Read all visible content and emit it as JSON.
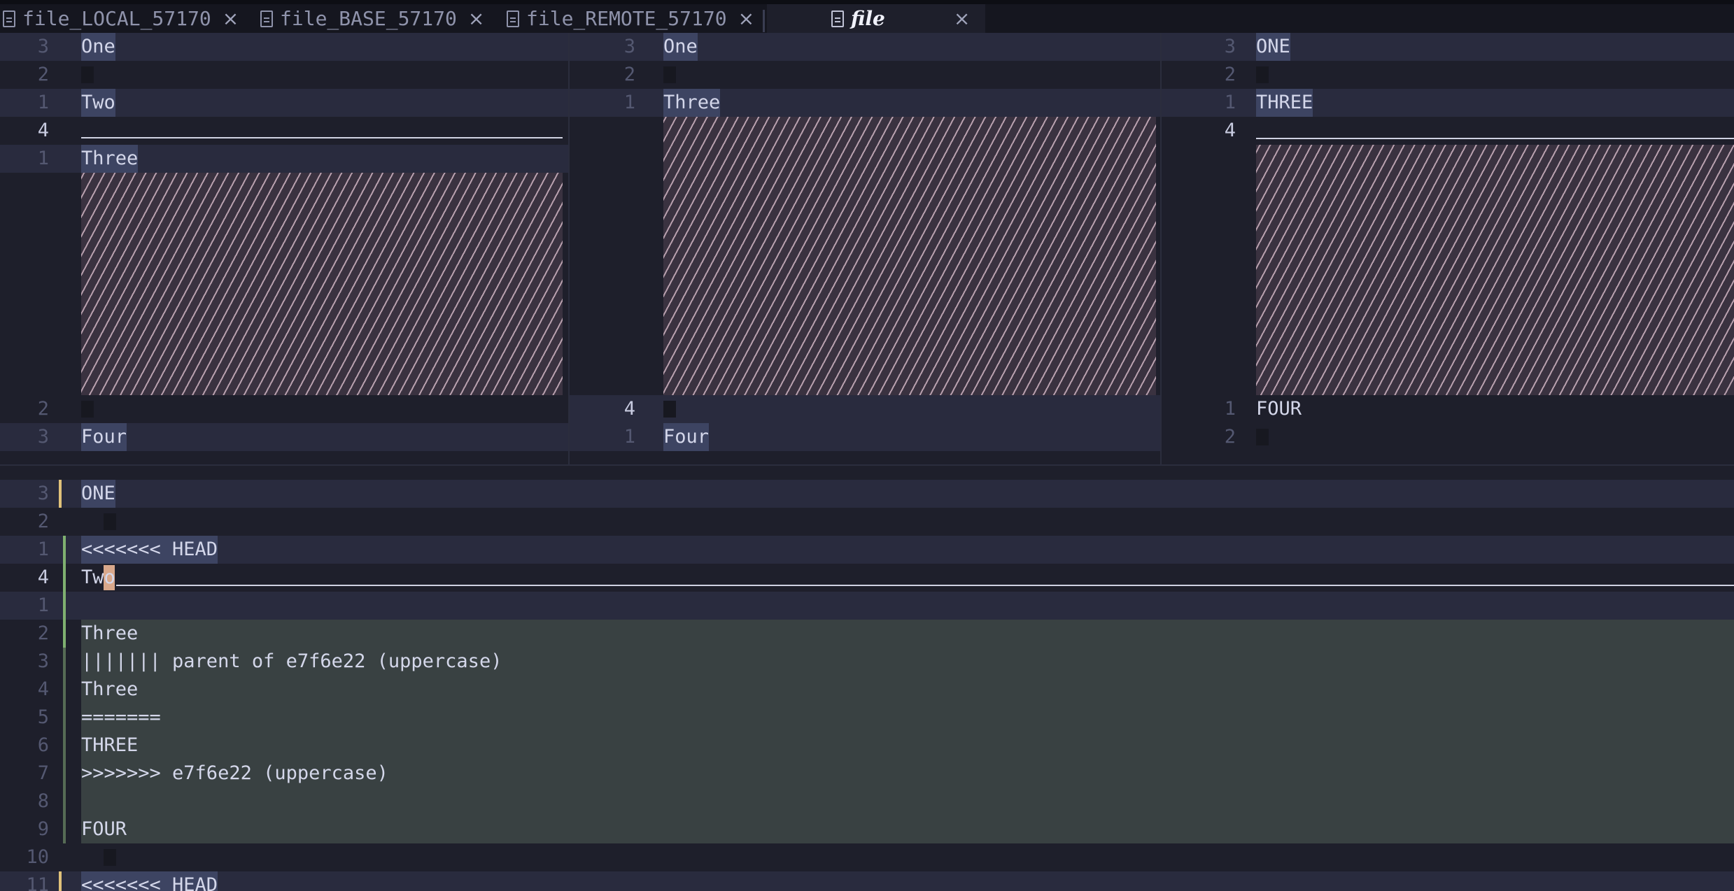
{
  "tabs": [
    {
      "label": "file_LOCAL_57170",
      "close": "×"
    },
    {
      "label": "file_BASE_57170",
      "close": "×"
    },
    {
      "label": "file_REMOTE_57170",
      "close": "×"
    },
    {
      "label": "file",
      "close": "×"
    }
  ],
  "icons": {
    "file": "file-icon",
    "close": "close-icon"
  },
  "local_pane": {
    "lines": [
      {
        "num": "3",
        "text": "One"
      },
      {
        "num": "2",
        "text": ""
      },
      {
        "num": "1",
        "text": "Two"
      },
      {
        "num": "4",
        "text": ""
      },
      {
        "num": "1",
        "text": "Three"
      },
      {
        "num": "2",
        "text": ""
      },
      {
        "num": "3",
        "text": "Four"
      }
    ]
  },
  "base_pane": {
    "lines": [
      {
        "num": "3",
        "text": "One"
      },
      {
        "num": "2",
        "text": ""
      },
      {
        "num": "1",
        "text": "Three"
      },
      {
        "num": "4",
        "text": ""
      },
      {
        "num": "1",
        "text": "Four"
      }
    ]
  },
  "remote_pane": {
    "lines": [
      {
        "num": "3",
        "text": "ONE"
      },
      {
        "num": "2",
        "text": ""
      },
      {
        "num": "1",
        "text": "THREE"
      },
      {
        "num": "4",
        "text": ""
      },
      {
        "num": "1",
        "text": "FOUR"
      },
      {
        "num": "2",
        "text": ""
      }
    ]
  },
  "merged_pane": {
    "lines": [
      {
        "num": "3",
        "text": "ONE"
      },
      {
        "num": "2",
        "text": ""
      },
      {
        "num": "1",
        "text": "<<<<<<< HEAD"
      },
      {
        "num": "4",
        "text": "Two"
      },
      {
        "num": "1",
        "text": ""
      },
      {
        "num": "2",
        "text": "Three"
      },
      {
        "num": "3",
        "text": "||||||| parent of e7f6e22 (uppercase)"
      },
      {
        "num": "4",
        "text": "Three"
      },
      {
        "num": "5",
        "text": "======="
      },
      {
        "num": "6",
        "text": "THREE"
      },
      {
        "num": "7",
        "text": ">>>>>>> e7f6e22 (uppercase)"
      },
      {
        "num": "8",
        "text": ""
      },
      {
        "num": "9",
        "text": "FOUR"
      },
      {
        "num": "10",
        "text": ""
      },
      {
        "num": "11",
        "text": "<<<<<<< HEAD"
      }
    ]
  },
  "colors": {
    "background": "#1e1f2b",
    "line_highlight": "#292b3e",
    "selection": "#3d4462",
    "deleted_hatch": "#b8a0ae",
    "conflict_bg": "#394142",
    "gutter_modified": "#e0c27a",
    "gutter_added": "#7fb070",
    "cursor": "#d9a88b"
  }
}
